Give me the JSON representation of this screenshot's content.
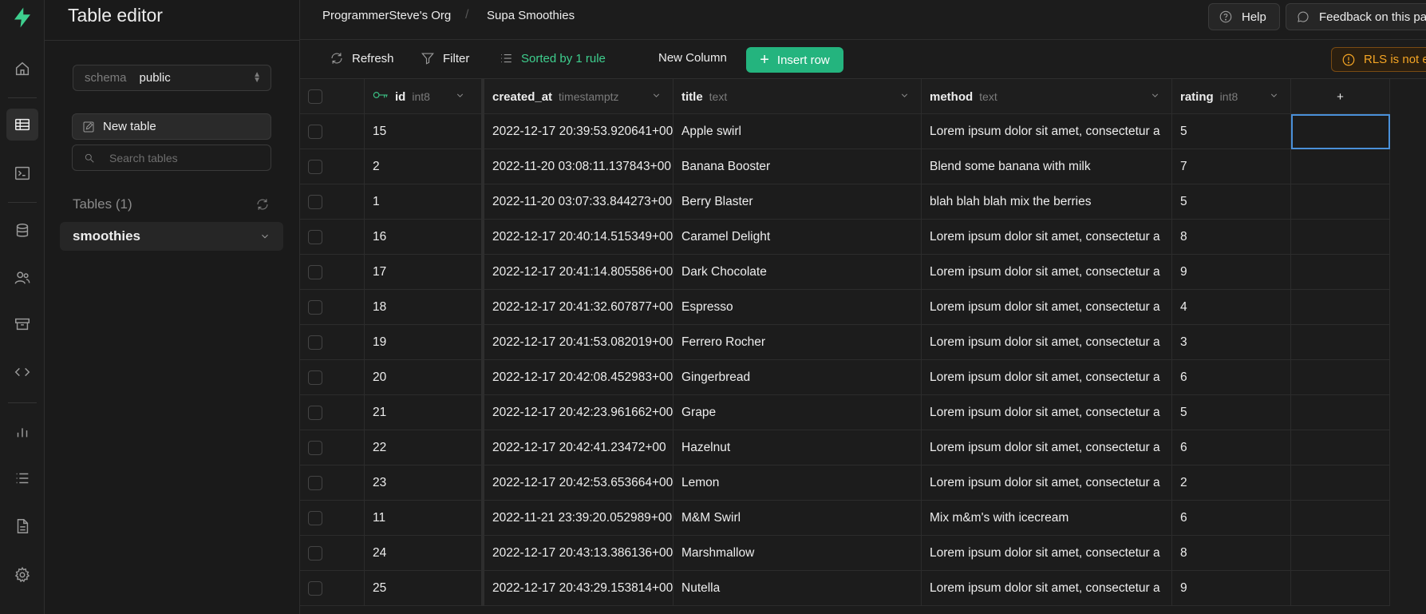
{
  "app": {
    "title": "Table editor"
  },
  "breadcrumb": {
    "org": "ProgrammerSteve's Org",
    "project": "Supa Smoothies"
  },
  "top_actions": {
    "help": "Help",
    "feedback": "Feedback on this pa"
  },
  "sidebar": {
    "schema_label": "schema",
    "schema_value": "public",
    "new_table": "New table",
    "search_placeholder": "Search tables",
    "tables_count_label": "Tables (1)",
    "tables": [
      {
        "name": "smoothies"
      }
    ]
  },
  "toolbar": {
    "refresh": "Refresh",
    "filter": "Filter",
    "sorted": "Sorted by 1 rule",
    "new_column": "New Column",
    "insert_row": "Insert row",
    "rls_warning": "RLS is not e"
  },
  "columns": [
    {
      "name": "id",
      "type": "int8"
    },
    {
      "name": "created_at",
      "type": "timestamptz"
    },
    {
      "name": "title",
      "type": "text"
    },
    {
      "name": "method",
      "type": "text"
    },
    {
      "name": "rating",
      "type": "int8"
    }
  ],
  "add_column_symbol": "+",
  "rows": [
    {
      "id": "15",
      "created_at": "2022-12-17 20:39:53.920641+00",
      "title": "Apple swirl",
      "method": "Lorem ipsum dolor sit amet, consectetur a",
      "rating": "5"
    },
    {
      "id": "2",
      "created_at": "2022-11-20 03:08:11.137843+00",
      "title": "Banana Booster",
      "method": "Blend some banana with milk",
      "rating": "7"
    },
    {
      "id": "1",
      "created_at": "2022-11-20 03:07:33.844273+00",
      "title": "Berry Blaster",
      "method": "blah blah blah mix the berries",
      "rating": "5"
    },
    {
      "id": "16",
      "created_at": "2022-12-17 20:40:14.515349+00",
      "title": "Caramel Delight",
      "method": "Lorem ipsum dolor sit amet, consectetur a",
      "rating": "8"
    },
    {
      "id": "17",
      "created_at": "2022-12-17 20:41:14.805586+00",
      "title": "Dark Chocolate",
      "method": "Lorem ipsum dolor sit amet, consectetur a",
      "rating": "9"
    },
    {
      "id": "18",
      "created_at": "2022-12-17 20:41:32.607877+00",
      "title": "Espresso",
      "method": "Lorem ipsum dolor sit amet, consectetur a",
      "rating": "4"
    },
    {
      "id": "19",
      "created_at": "2022-12-17 20:41:53.082019+00",
      "title": "Ferrero Rocher",
      "method": "Lorem ipsum dolor sit amet, consectetur a",
      "rating": "3"
    },
    {
      "id": "20",
      "created_at": "2022-12-17 20:42:08.452983+00",
      "title": "Gingerbread",
      "method": "Lorem ipsum dolor sit amet, consectetur a",
      "rating": "6"
    },
    {
      "id": "21",
      "created_at": "2022-12-17 20:42:23.961662+00",
      "title": "Grape",
      "method": "Lorem ipsum dolor sit amet, consectetur a",
      "rating": "5"
    },
    {
      "id": "22",
      "created_at": "2022-12-17 20:42:41.23472+00",
      "title": "Hazelnut",
      "method": "Lorem ipsum dolor sit amet, consectetur a",
      "rating": "6"
    },
    {
      "id": "23",
      "created_at": "2022-12-17 20:42:53.653664+00",
      "title": "Lemon",
      "method": "Lorem ipsum dolor sit amet, consectetur a",
      "rating": "2"
    },
    {
      "id": "11",
      "created_at": "2022-11-21 23:39:20.052989+00",
      "title": "M&M Swirl",
      "method": "Mix m&m's with icecream",
      "rating": "6"
    },
    {
      "id": "24",
      "created_at": "2022-12-17 20:43:13.386136+00",
      "title": "Marshmallow",
      "method": "Lorem ipsum dolor sit amet, consectetur a",
      "rating": "8"
    },
    {
      "id": "25",
      "created_at": "2022-12-17 20:43:29.153814+00",
      "title": "Nutella",
      "method": "Lorem ipsum dolor sit amet, consectetur a",
      "rating": "9"
    }
  ],
  "colors": {
    "accent": "#3ecf8e",
    "insert_button": "#24b47e",
    "warning": "#f5a524",
    "selection": "#4a90d9"
  },
  "icons": {
    "rail": [
      "supabase-logo-icon",
      "home-icon",
      "table-editor-icon",
      "sql-editor-icon",
      "database-icon",
      "auth-users-icon",
      "storage-icon",
      "edge-functions-icon",
      "reports-icon",
      "logs-icon",
      "api-docs-icon",
      "settings-icon"
    ]
  }
}
